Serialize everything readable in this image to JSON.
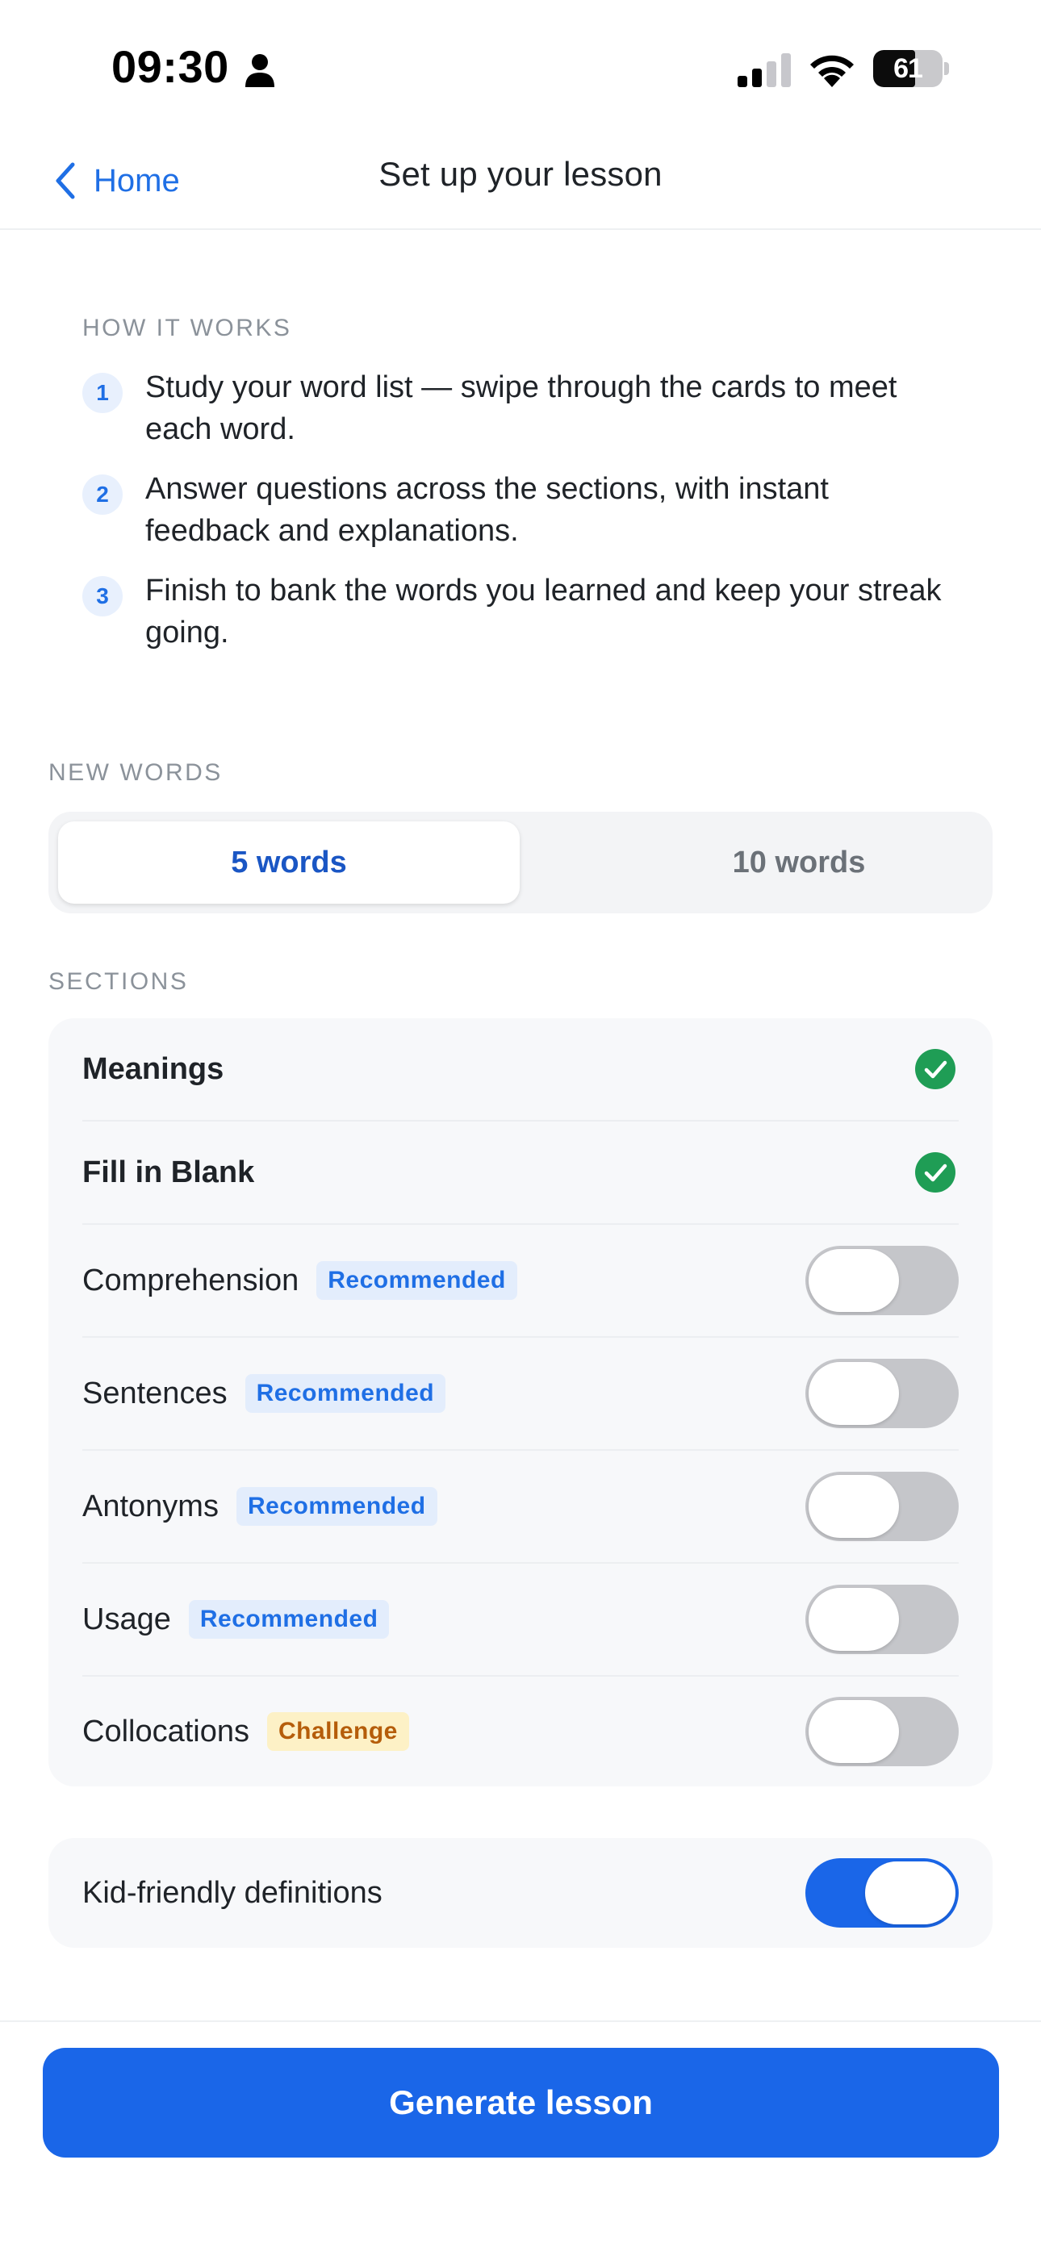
{
  "status_bar": {
    "time": "09:30",
    "battery": "61",
    "battery_level": 0.61
  },
  "nav": {
    "back_label": "Home",
    "title": "Set up your lesson"
  },
  "how_it_works": {
    "heading": "HOW IT WORKS",
    "steps": [
      {
        "num": "1",
        "text": "Study your word list — swipe through the cards to meet each word."
      },
      {
        "num": "2",
        "text": "Answer questions across the sections, with instant feedback and explanations."
      },
      {
        "num": "3",
        "text": "Finish to bank the words you learned and keep your streak going."
      }
    ]
  },
  "new_words": {
    "heading": "NEW WORDS",
    "options": [
      "5 words",
      "10 words"
    ],
    "selected": "5 words"
  },
  "sections": {
    "heading": "SECTIONS",
    "items": [
      {
        "label": "Meanings",
        "control": "check",
        "enabled": true
      },
      {
        "label": "Fill in Blank",
        "control": "check",
        "enabled": true
      },
      {
        "label": "Comprehension",
        "badge": "Recommended",
        "control": "toggle",
        "enabled": false
      },
      {
        "label": "Sentences",
        "badge": "Recommended",
        "control": "toggle",
        "enabled": false
      },
      {
        "label": "Antonyms",
        "badge": "Recommended",
        "control": "toggle",
        "enabled": false
      },
      {
        "label": "Usage",
        "badge": "Recommended",
        "control": "toggle",
        "enabled": false
      },
      {
        "label": "Collocations",
        "badge": "Challenge",
        "control": "toggle",
        "enabled": false
      }
    ]
  },
  "options": {
    "kid_friendly_label": "Kid-friendly definitions",
    "kid_friendly_enabled": true
  },
  "cta": {
    "label": "Generate lesson"
  },
  "colors": {
    "accent": "#1a66e8",
    "success": "#1f9d55",
    "badge_blue": "#e3edfc",
    "badge_yellow": "#fdf1c6"
  },
  "icons": {
    "back": "chevron-left-icon",
    "check": "checkmark-circle-icon",
    "person": "person-icon",
    "signal": "cellular-signal-icon",
    "wifi": "wifi-icon"
  }
}
